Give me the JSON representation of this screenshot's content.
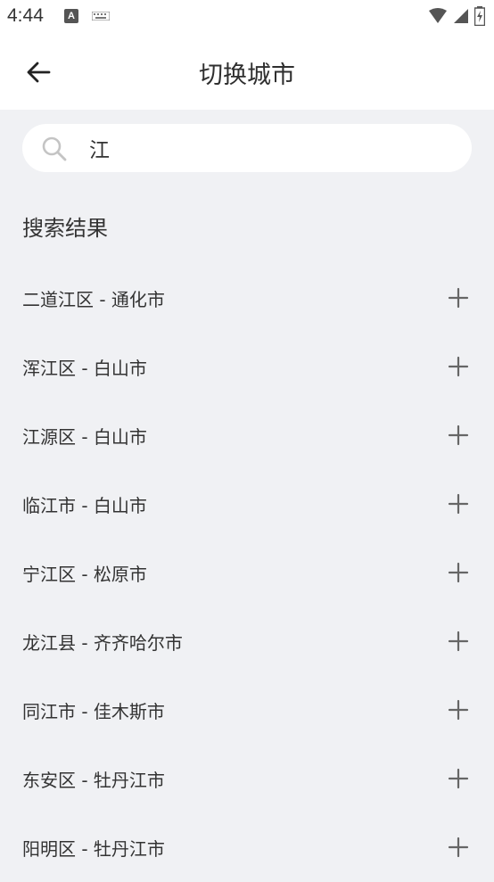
{
  "status_bar": {
    "time": "4:44",
    "notification_letter": "A"
  },
  "app_bar": {
    "title": "切换城市"
  },
  "search": {
    "value": "江"
  },
  "results_section": {
    "title": "搜索结果"
  },
  "results": [
    {
      "label": "二道江区 - 通化市"
    },
    {
      "label": "浑江区 - 白山市"
    },
    {
      "label": "江源区 - 白山市"
    },
    {
      "label": "临江市 - 白山市"
    },
    {
      "label": "宁江区 - 松原市"
    },
    {
      "label": "龙江县 - 齐齐哈尔市"
    },
    {
      "label": "同江市 - 佳木斯市"
    },
    {
      "label": "东安区 - 牡丹江市"
    },
    {
      "label": "阳明区 - 牡丹江市"
    }
  ],
  "colors": {
    "background": "#f0f1f4",
    "surface": "#ffffff",
    "text": "#333333",
    "icon": "#666666"
  }
}
